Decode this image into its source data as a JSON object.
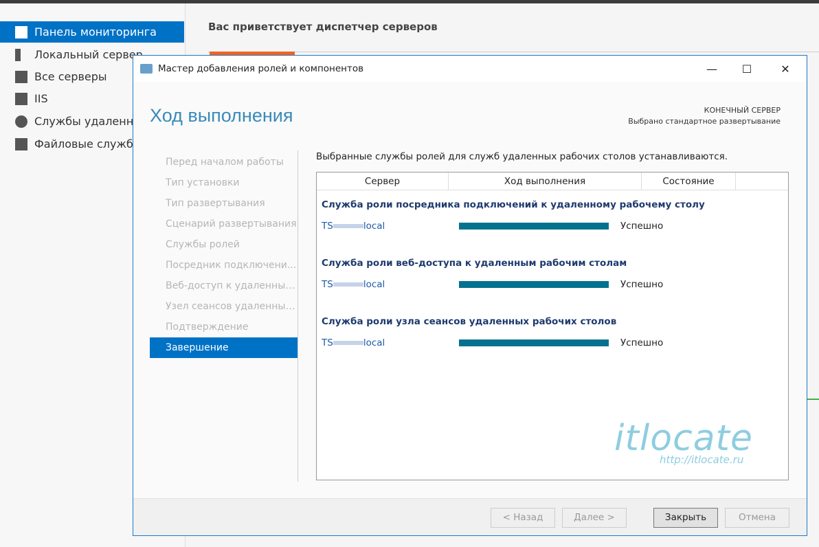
{
  "background": {
    "sidebar": [
      {
        "label": "Панель мониторинга",
        "selected": true
      },
      {
        "label": "Локальный сервер"
      },
      {
        "label": "Все серверы"
      },
      {
        "label": "IIS"
      },
      {
        "label": "Службы удаленных"
      },
      {
        "label": "Файловые службы"
      }
    ],
    "welcome": "Вас приветствует диспетчер серверов"
  },
  "dialog": {
    "title": "Мастер добавления ролей и компонентов",
    "heading": "Ход выполнения",
    "dest_label": "КОНЕЧНЫЙ СЕРВЕР",
    "dest_value": "Выбрано стандартное развертывание",
    "nav": [
      "Перед началом работы",
      "Тип установки",
      "Тип развертывания",
      "Сценарий развертывания",
      "Службы ролей",
      "Посредник подключени...",
      "Веб-доступ к удаленным...",
      "Узел сеансов удаленных...",
      "Подтверждение",
      "Завершение"
    ],
    "intro": "Выбранные службы ролей для служб удаленных рабочих столов устанавливаются.",
    "columns": [
      "Сервер",
      "Ход выполнения",
      "Состояние"
    ],
    "groups": [
      {
        "title": "Служба роли посредника подключений к удаленному рабочему столу",
        "server_prefix": "TS",
        "server_suffix": "local",
        "progress": 100,
        "status": "Успешно"
      },
      {
        "title": "Служба роли веб-доступа к удаленным рабочим столам",
        "server_prefix": "TS",
        "server_suffix": "local",
        "progress": 100,
        "status": "Успешно"
      },
      {
        "title": "Служба роли узла сеансов удаленных рабочих столов",
        "server_prefix": "TS",
        "server_suffix": "local",
        "progress": 100,
        "status": "Успешно"
      }
    ],
    "buttons": {
      "back": "< Назад",
      "next": "Далее >",
      "close": "Закрыть",
      "cancel": "Отмена"
    }
  },
  "watermark": {
    "logo": "itlocate",
    "url": "http://itlocate.ru"
  }
}
